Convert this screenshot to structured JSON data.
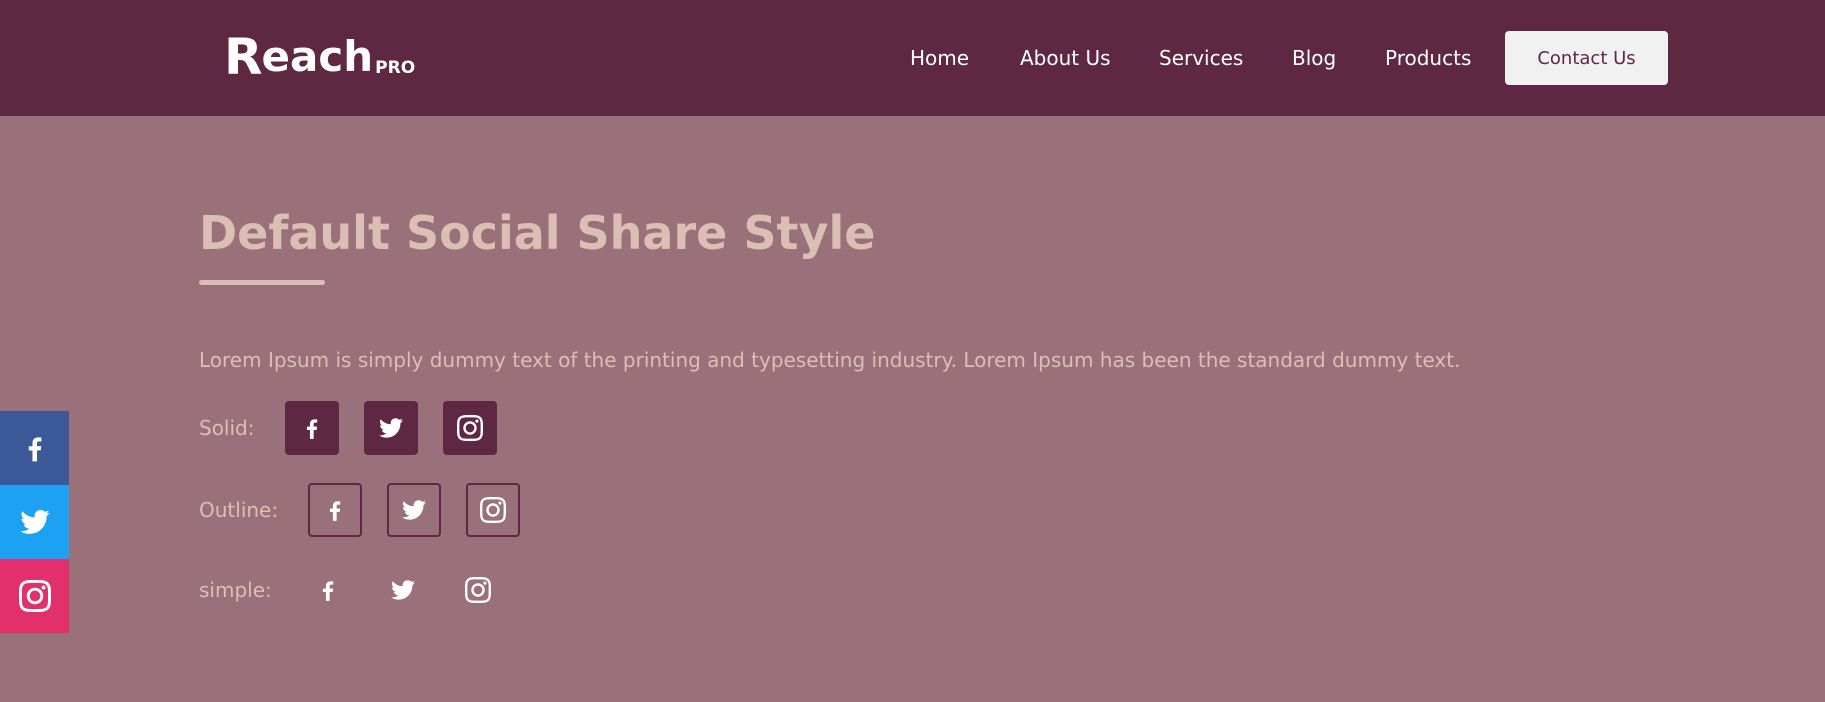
{
  "header": {
    "logo": {
      "r": "R",
      "each": "each",
      "pro": "PRO"
    },
    "nav": [
      {
        "label": "Home"
      },
      {
        "label": "About Us"
      },
      {
        "label": "Services"
      },
      {
        "label": "Blog"
      },
      {
        "label": "Products"
      }
    ],
    "contact_label": "Contact Us"
  },
  "main": {
    "title": "Default Social Share Style",
    "description": "Lorem Ipsum is simply dummy text of the printing and typesetting industry. Lorem Ipsum has been the standard dummy text.",
    "rows": [
      {
        "label": "Solid:"
      },
      {
        "label": "Outline:"
      },
      {
        "label": "simple:"
      }
    ]
  },
  "icons": [
    "facebook-icon",
    "twitter-icon",
    "instagram-icon"
  ],
  "colors": {
    "header_bg": "#5e2742",
    "page_bg": "#9a717a",
    "accent_text": "#dbbfb4",
    "facebook": "#3b5998",
    "twitter": "#1da1f2",
    "instagram": "#e1306c"
  }
}
